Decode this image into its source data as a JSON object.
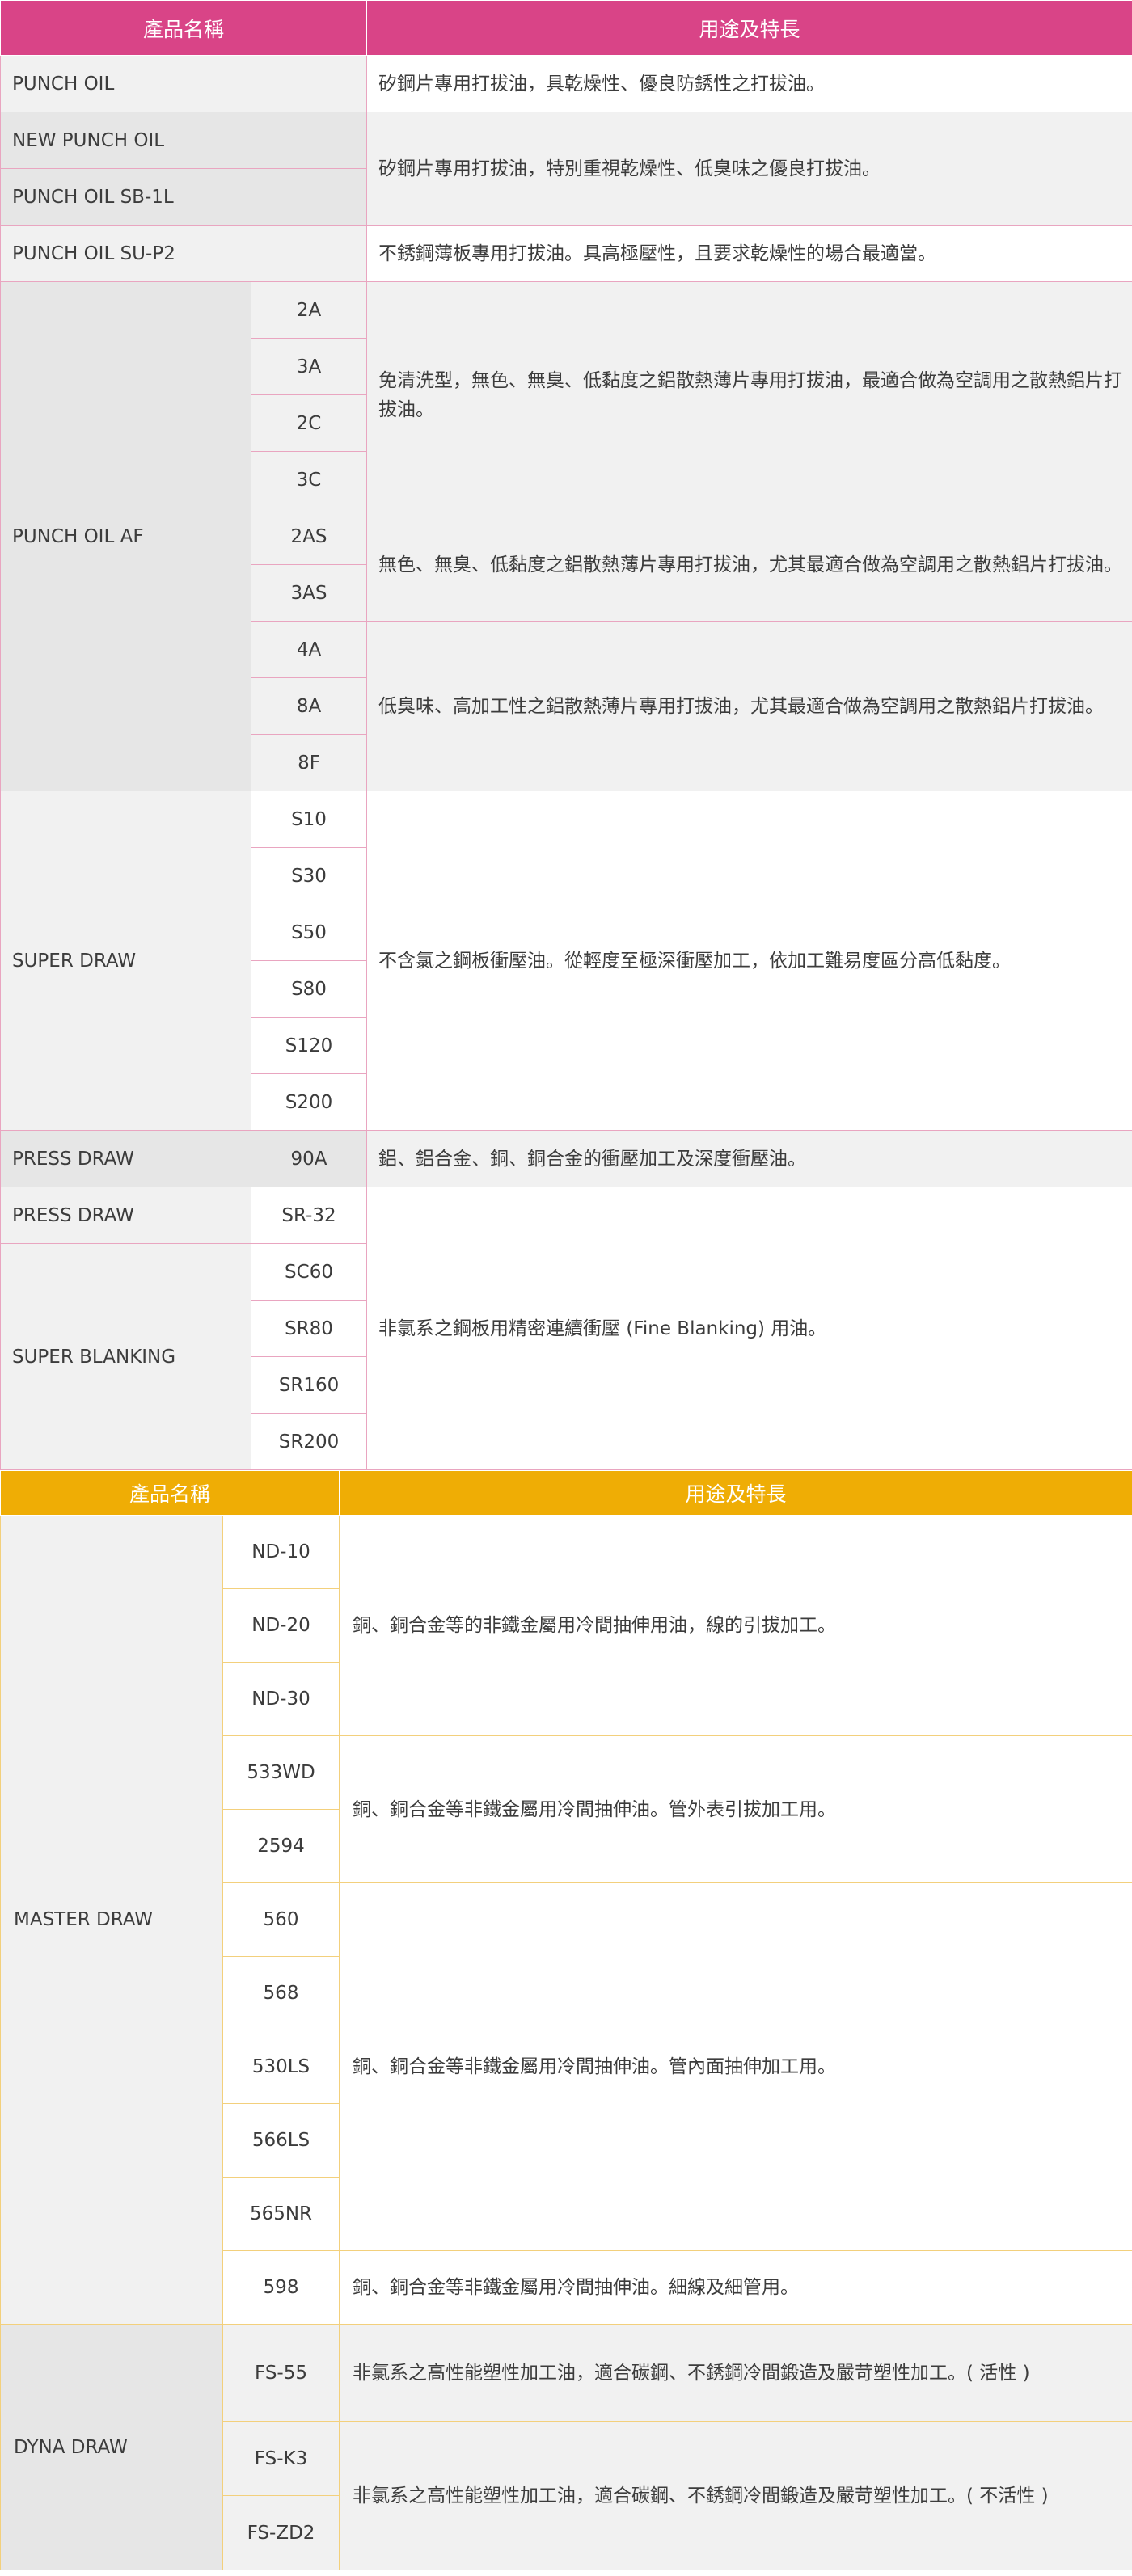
{
  "table1": {
    "headers": {
      "name": "產品名稱",
      "usage": "用途及特長"
    },
    "punch_oil": {
      "name": "PUNCH OIL",
      "desc": "矽鋼片專用打拔油，具乾燥性、優良防銹性之打拔油。"
    },
    "new_punch_oil": {
      "name": "NEW PUNCH OIL"
    },
    "punch_oil_sb1l": {
      "name": "PUNCH OIL SB-1L",
      "desc": "矽鋼片專用打拔油，特別重視乾燥性、低臭味之優良打拔油。"
    },
    "punch_oil_sup2": {
      "name": "PUNCH OIL SU-P2",
      "desc": "不銹鋼薄板專用打拔油。具高極壓性，且要求乾燥性的場合最適當。"
    },
    "punch_oil_af": {
      "name": "PUNCH OIL AF",
      "codes": [
        "2A",
        "3A",
        "2C",
        "3C",
        "2AS",
        "3AS",
        "4A",
        "8A",
        "8F"
      ],
      "desc1": "免清洗型，無色、無臭、低黏度之鋁散熱薄片專用打拔油，最適合做為空調用之散熱鋁片打拔油。",
      "desc2": "無色、無臭、低黏度之鋁散熱薄片專用打拔油，尤其最適合做為空調用之散熱鋁片打拔油。",
      "desc3": "低臭味、高加工性之鋁散熱薄片專用打拔油，尤其最適合做為空調用之散熱鋁片打拔油。"
    },
    "super_draw": {
      "name": "SUPER DRAW",
      "codes": [
        "S10",
        "S30",
        "S50",
        "S80",
        "S120",
        "S200"
      ],
      "desc": "不含氯之鋼板衝壓油。從輕度至極深衝壓加工，依加工難易度區分高低黏度。"
    },
    "press_draw_90a": {
      "name": "PRESS DRAW",
      "code": "90A",
      "desc": "鋁、鋁合金、銅、銅合金的衝壓加工及深度衝壓油。"
    },
    "press_draw_sr32": {
      "name": "PRESS DRAW",
      "code": "SR-32"
    },
    "super_blanking": {
      "name": "SUPER BLANKING",
      "codes": [
        "SC60",
        "SR80",
        "SR160",
        "SR200"
      ],
      "desc": "非氯系之鋼板用精密連續衝壓 (Fine Blanking) 用油。"
    }
  },
  "table2": {
    "headers": {
      "name": "產品名稱",
      "usage": "用途及特長"
    },
    "master_draw": {
      "name": "MASTER DRAW",
      "codes": [
        "ND-10",
        "ND-20",
        "ND-30",
        "533WD",
        "2594",
        "560",
        "568",
        "530LS",
        "566LS",
        "565NR",
        "598"
      ],
      "desc1": "銅、銅合金等的非鐵金屬用冷間抽伸用油，線的引拔加工。",
      "desc2": "銅、銅合金等非鐵金屬用冷間抽伸油。管外表引拔加工用。",
      "desc3": "銅、銅合金等非鐵金屬用冷間抽伸油。管內面抽伸加工用。",
      "desc4": "銅、銅合金等非鐵金屬用冷間抽伸油。細線及細管用。"
    },
    "dyna_draw": {
      "name": "DYNA DRAW",
      "codes": [
        "FS-55",
        "FS-K3",
        "FS-ZD2"
      ],
      "desc1": "非氯系之高性能塑性加工油，適合碳鋼、不銹鋼冷間鍛造及嚴苛塑性加工。( 活性 )",
      "desc2": "非氯系之高性能塑性加工油，適合碳鋼、不銹鋼冷間鍛造及嚴苛塑性加工。( 不活性 )"
    }
  },
  "colors": {
    "pink_header": "#d94487",
    "pink_border": "#e9a5c0",
    "yellow_header": "#efad05",
    "yellow_border": "#f3d07c",
    "gray_cell": "#e6e6e6"
  }
}
